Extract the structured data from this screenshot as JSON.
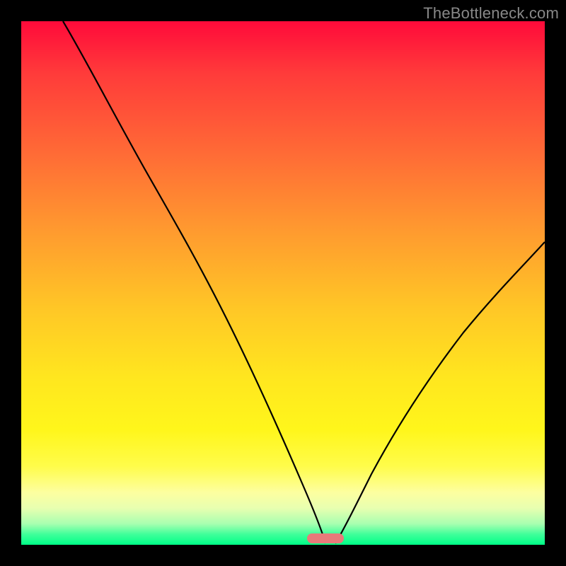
{
  "watermark": "TheBottleneck.com",
  "chart_data": {
    "type": "line",
    "title": "",
    "xlabel": "",
    "ylabel": "",
    "xlim": [
      0,
      100
    ],
    "ylim": [
      0,
      100
    ],
    "grid": false,
    "legend": false,
    "gradient_stops": [
      {
        "pos": 0,
        "color": "#ff0a3a"
      },
      {
        "pos": 10,
        "color": "#ff3b3a"
      },
      {
        "pos": 25,
        "color": "#ff6a36"
      },
      {
        "pos": 40,
        "color": "#ff9a2f"
      },
      {
        "pos": 55,
        "color": "#ffc726"
      },
      {
        "pos": 68,
        "color": "#ffe61f"
      },
      {
        "pos": 78,
        "color": "#fff61b"
      },
      {
        "pos": 85,
        "color": "#fffc4a"
      },
      {
        "pos": 90,
        "color": "#fdffa0"
      },
      {
        "pos": 93,
        "color": "#e8ffb0"
      },
      {
        "pos": 96,
        "color": "#a8ffb0"
      },
      {
        "pos": 98,
        "color": "#3fff9a"
      },
      {
        "pos": 100,
        "color": "#00ff88"
      }
    ],
    "optimal_marker": {
      "x": 58,
      "y": 99,
      "width": 7,
      "height": 2,
      "color": "#e87a7a"
    },
    "series": [
      {
        "name": "left-curve",
        "x": [
          8,
          12,
          18,
          24,
          30,
          36,
          42,
          48,
          52,
          55,
          57,
          58
        ],
        "y": [
          100,
          93,
          82,
          71,
          60,
          48.5,
          37,
          24,
          14,
          6,
          2,
          0
        ]
      },
      {
        "name": "right-curve",
        "x": [
          60,
          63,
          67,
          72,
          78,
          85,
          92,
          100
        ],
        "y": [
          0,
          3,
          8,
          15,
          24,
          35,
          46,
          58
        ]
      }
    ]
  }
}
